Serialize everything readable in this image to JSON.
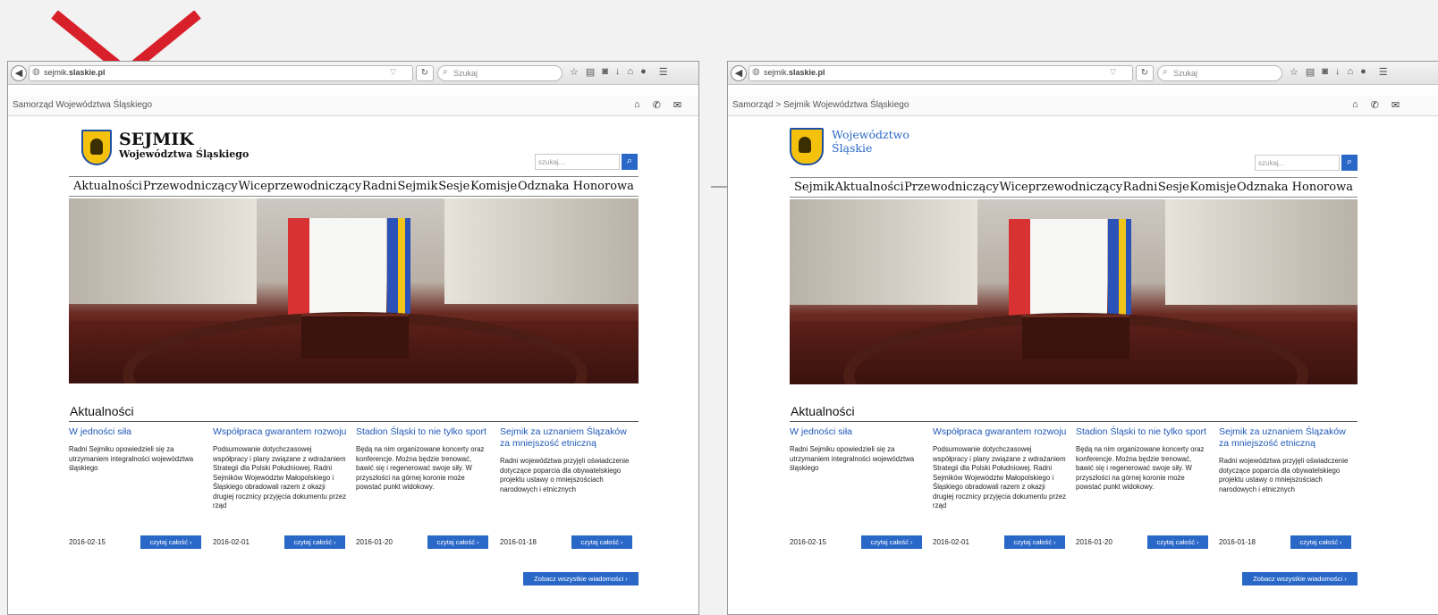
{
  "browser": {
    "url_prefix": "sejmik.",
    "url_domain": "slaskie.pl",
    "search_placeholder": "Szukaj"
  },
  "breadcrumb_left": "Samorząd Województwa Śląskiego",
  "breadcrumb_right": "Samorząd > Sejmik Województwa Śląskiego",
  "left_site": {
    "logo_line1": "SEJMIK",
    "logo_line2": "Województwa Śląskiego",
    "menu": [
      "Aktualności",
      "Przewodniczący",
      "Wiceprzewodniczący",
      "Radni",
      "Sejmik",
      "Sesje",
      "Komisje",
      "Odznaka Honorowa"
    ]
  },
  "right_site": {
    "logo_line1": "Województwo",
    "logo_line2": "Śląskie",
    "menu": [
      "Sejmik",
      "Aktualności",
      "Przewodniczący",
      "Wiceprzewodniczący",
      "Radni",
      "Sesje",
      "Komisje",
      "Odznaka Honorowa"
    ]
  },
  "site_search_placeholder": "szukaj...",
  "news_title": "Aktualności",
  "news": [
    {
      "title": "W jedności siła",
      "text": "Radni Sejmiku opowiedzieli się za utrzymaniem integralności województwa śląskiego",
      "date": "2016-02-15",
      "more": "czytaj całość ›"
    },
    {
      "title": "Współpraca gwarantem rozwoju",
      "text": "Podsumowanie dotychczasowej współpracy i plany związane z wdrażaniem Strategii dla Polski Południowej. Radni Sejmików Województw Małopolskiego i Śląskiego obradowali razem z okazji drugiej rocznicy przyjęcia dokumentu przez rząd",
      "date": "2016-02-01",
      "more": "czytaj całość ›"
    },
    {
      "title": "Stadion Śląski to nie tylko sport",
      "text": "Będą na nim organizowane koncerty oraz konferencje. Można będzie trenować, bawić się i regenerować swoje siły. W przyszłości na górnej koronie może powstać punkt widokowy.",
      "date": "2016-01-20",
      "more": "czytaj całość ›"
    },
    {
      "title": "Sejmik za uznaniem Ślązaków za mniejszość etniczną",
      "text": "Radni województwa przyjęli oświadczenie dotyczące poparcia dla obywatelskiego projektu ustawy o mniejszościach narodowych i etnicznych",
      "date": "2016-01-18",
      "more": "czytaj całość ›"
    }
  ],
  "all_news_label": "Zobacz wszystkie wiadomości ›",
  "colors": {
    "reject": "#d8202a",
    "accent": "#2a68c8"
  }
}
